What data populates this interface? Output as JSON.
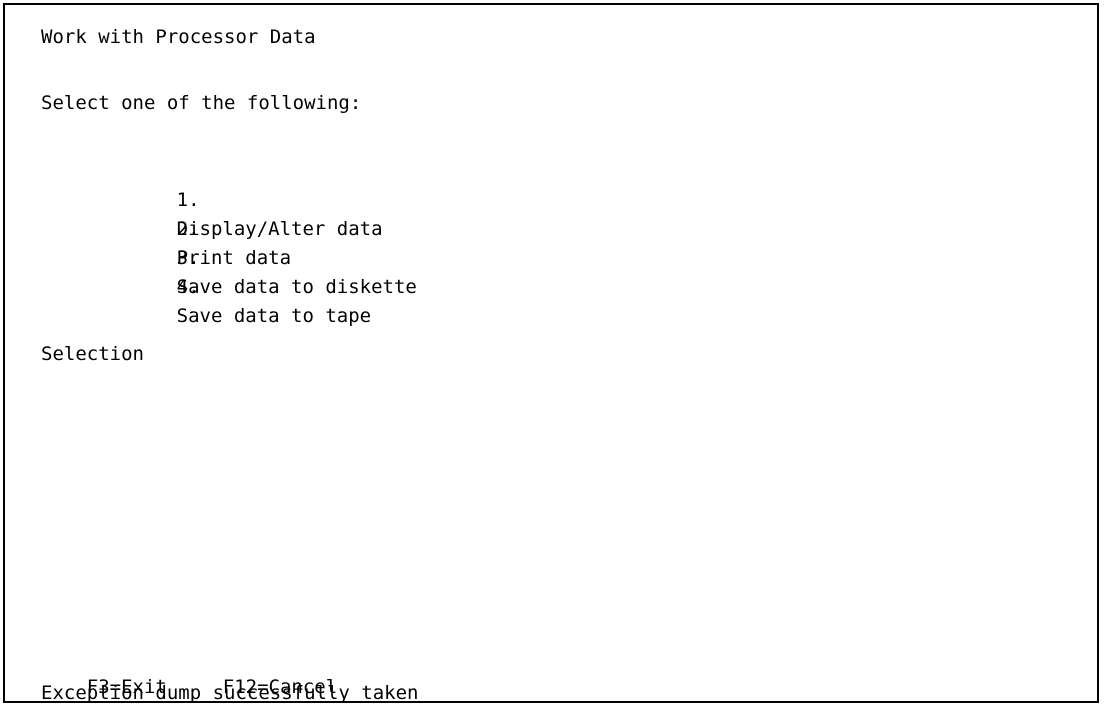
{
  "screen": {
    "title": "Work with Processor Data",
    "prompt": "Select one of the following:",
    "options": [
      {
        "number": "1.",
        "label": "Display/Alter data"
      },
      {
        "number": "2.",
        "label": "Print data"
      },
      {
        "number": "3.",
        "label": "Save data to diskette"
      },
      {
        "number": "4.",
        "label": "Save data to tape"
      }
    ],
    "selection_label": "Selection",
    "function_keys": {
      "f3": "F3=Exit",
      "f12": "F12=Cancel"
    },
    "message": "Exception dump successfully taken"
  }
}
